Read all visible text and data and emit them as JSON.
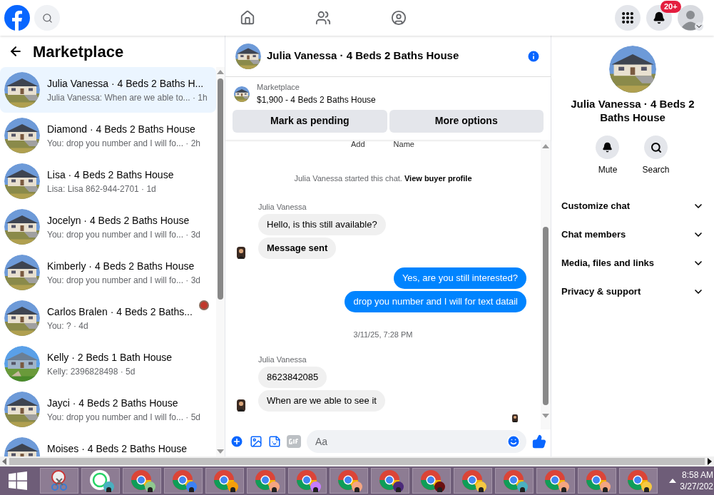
{
  "top_bar": {
    "badge": "20+"
  },
  "sidebar": {
    "title": "Marketplace",
    "conversations": [
      {
        "title": "Julia Vanessa · 4 Beds 2 Baths H...",
        "preview": "Julia Vanessa: When are we able to... · 1h",
        "selected": true,
        "seen": false,
        "kind": "gray"
      },
      {
        "title": "Diamond · 4 Beds 2 Baths House",
        "preview": "You: drop you number and I will fo... · 2h",
        "selected": false,
        "seen": false,
        "kind": "gray"
      },
      {
        "title": "Lisa · 4 Beds 2 Baths House",
        "preview": "Lisa: Lisa 862-944-2701 · 1d",
        "selected": false,
        "seen": false,
        "kind": "gray"
      },
      {
        "title": "Jocelyn · 4 Beds 2 Baths House",
        "preview": "You: drop you number and I will fo... · 3d",
        "selected": false,
        "seen": false,
        "kind": "gray"
      },
      {
        "title": "Kimberly · 4 Beds 2 Baths House",
        "preview": "You: drop you number and I will fo... · 3d",
        "selected": false,
        "seen": false,
        "kind": "gray"
      },
      {
        "title": "Carlos Bralen · 4 Beds 2 Baths...",
        "preview": "You: ? · 4d",
        "selected": false,
        "seen": true,
        "kind": "gray"
      },
      {
        "title": "Kelly · 2 Beds 1 Bath House",
        "preview": "Kelly: 2396828498 · 5d",
        "selected": false,
        "seen": false,
        "kind": "blue"
      },
      {
        "title": "Jayci · 4 Beds 2 Baths House",
        "preview": "You: drop you number and I will fo... · 5d",
        "selected": false,
        "seen": false,
        "kind": "gray"
      },
      {
        "title": "Moises · 4 Beds 2 Baths House",
        "selected": false,
        "seen": false,
        "kind": "gray"
      }
    ]
  },
  "chat": {
    "title": "Julia Vanessa · 4 Beds 2 Baths House",
    "listing": {
      "source": "Marketplace",
      "summary": "$1,900 - 4 Beds 2 Baths House",
      "buttons": [
        "Mark as pending",
        "More options"
      ]
    },
    "cut_labels": [
      "Add",
      "Name"
    ],
    "messages": [
      {
        "kind": "system",
        "text": "Julia Vanessa started this chat.",
        "link": "View buyer profile"
      },
      {
        "kind": "sender",
        "text": "Julia Vanessa"
      },
      {
        "kind": "incoming",
        "text": "Hello, is this still available?",
        "avatar": false,
        "bold": false
      },
      {
        "kind": "incoming",
        "text": "Message sent",
        "avatar": true,
        "bold": true
      },
      {
        "kind": "outgoing",
        "text": "Yes, are you still interested?"
      },
      {
        "kind": "outgoing",
        "text": "drop you number and I will for text datail"
      },
      {
        "kind": "timestamp",
        "text": "3/11/25, 7:28 PM"
      },
      {
        "kind": "sender",
        "text": "Julia Vanessa"
      },
      {
        "kind": "incoming",
        "text": "8623842085",
        "avatar": false,
        "bold": false
      },
      {
        "kind": "incoming",
        "text": "When are we able to see it",
        "avatar": true,
        "bold": false
      },
      {
        "kind": "seen"
      }
    ],
    "composer": {
      "placeholder": "Aa"
    }
  },
  "details": {
    "title": "Julia Vanessa · 4 Beds 2 Baths House",
    "actions": [
      {
        "kind": "mute",
        "label": "Mute"
      },
      {
        "kind": "search",
        "label": "Search"
      }
    ],
    "sections": [
      {
        "label": "Customize chat",
        "expanded": false
      },
      {
        "label": "Chat members",
        "expanded": false
      },
      {
        "label": "Media, files and links",
        "expanded": false
      },
      {
        "label": "Privacy & support",
        "expanded": false
      }
    ]
  },
  "taskbar": {
    "apps": [
      {
        "kind": "snip"
      },
      {
        "kind": "whatsapp",
        "color": "#4ab0c0"
      },
      {
        "kind": "chrome",
        "color": "#8fc98f"
      },
      {
        "kind": "chrome",
        "color": "#3b82f6"
      },
      {
        "kind": "chrome",
        "color": "#f59e0b"
      },
      {
        "kind": "chrome",
        "color": "#f4a582"
      },
      {
        "kind": "chrome",
        "color": "#c77dff"
      },
      {
        "kind": "chrome",
        "color": "#f4a582"
      },
      {
        "kind": "chrome",
        "color": "#4b2a7a"
      },
      {
        "kind": "chrome",
        "color": "#6b1010"
      },
      {
        "kind": "chrome",
        "color": "#f5c842"
      },
      {
        "kind": "chrome",
        "color": "#4ab0c0"
      },
      {
        "kind": "chrome",
        "color": "#f4a582"
      },
      {
        "kind": "chrome",
        "color": "#f4a582"
      },
      {
        "kind": "chrome",
        "color": "#f5c842"
      }
    ],
    "time": "8:58 AM",
    "date": "3/27/202"
  }
}
